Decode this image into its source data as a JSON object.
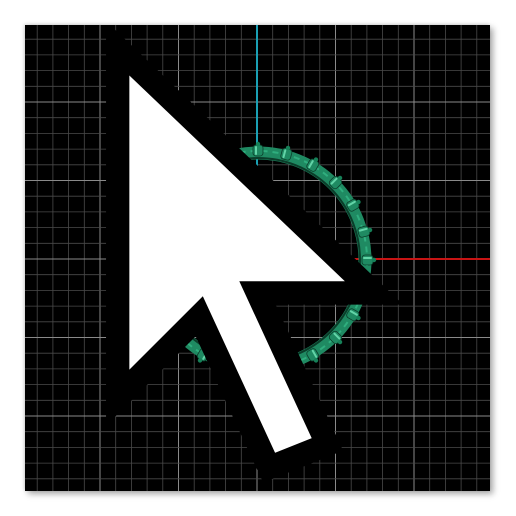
{
  "viewport": {
    "view": "top",
    "background_color": "#000000",
    "grid_minor_color": "#4a4a4a",
    "grid_major_color": "#8a8a8a",
    "axis_x_color": "#c81414",
    "axis_y_color": "#1aa0b4",
    "grid_visible": true
  },
  "model": {
    "object": "ring-band",
    "body_color": "#1f8a62",
    "highlight_color": "#6fe0b4",
    "shadow_color": "#0b3d2a",
    "segment_count": 24
  },
  "cursor": {
    "icon": "arrow-cursor-icon"
  }
}
